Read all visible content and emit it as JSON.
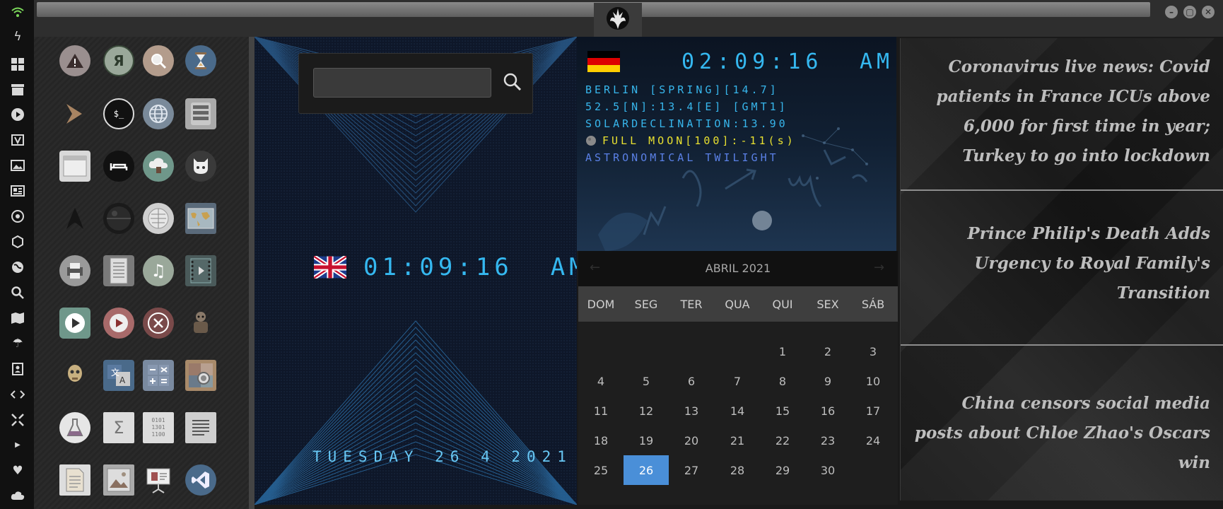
{
  "top": {
    "window_controls": [
      "–",
      "▢",
      "✕"
    ]
  },
  "left_bar": {
    "icons": [
      "wifi-icon",
      "flash-icon",
      "windows-icon",
      "archive-icon",
      "play-icon",
      "translate-map-icon",
      "image-icon",
      "news-icon",
      "rebel-icon",
      "hexagon-icon",
      "globe-icon",
      "search-icon",
      "map-icon",
      "umbrella-icon",
      "contacts-icon",
      "code-icon",
      "resize-icon",
      "youtube-icon",
      "heart-icon",
      "cloud-icon"
    ]
  },
  "launcher": {
    "apps": [
      "warning",
      "yandex",
      "search",
      "hourglass",
      "terminal-arrow",
      "terminal",
      "globe",
      "drive",
      "window",
      "sleep",
      "cloud-lock",
      "github",
      "star-trek",
      "death-star",
      "wikipedia",
      "world-map",
      "printer",
      "document-viewer",
      "music",
      "video",
      "play",
      "youtube-dl",
      "close",
      "robot",
      "c3po",
      "translate",
      "calculator",
      "photos",
      "lab",
      "sigma",
      "binary",
      "text-editor",
      "notes",
      "image",
      "presentation",
      "vscode"
    ]
  },
  "search": {
    "placeholder": "",
    "value": ""
  },
  "uk_clock": {
    "time": "01:09:16",
    "ampm": "AM",
    "date": "TUESDAY 26 4 2021"
  },
  "de_clock": {
    "time": "02:09:16",
    "ampm": "AM",
    "location_line": "BERLIN [SPRING][14.7]",
    "coords_line": "52.5[N]:13.4[E] [GMT1]",
    "declination_line": "SOLARDECLINATION:13.90",
    "moon_line": "FULL MOON[100]:-11(s)",
    "twilight_line": "ASTRONOMICAL TWILIGHT"
  },
  "calendar": {
    "title": "ABRIL 2021",
    "prev": "←",
    "next": "→",
    "weekdays": [
      "DOM",
      "SEG",
      "TER",
      "QUA",
      "QUI",
      "SEX",
      "SÁB"
    ],
    "weeks": [
      [
        "",
        "",
        "",
        "",
        "1",
        "2",
        "3"
      ],
      [
        "4",
        "5",
        "6",
        "7",
        "8",
        "9",
        "10"
      ],
      [
        "11",
        "12",
        "13",
        "14",
        "15",
        "16",
        "17"
      ],
      [
        "18",
        "19",
        "20",
        "21",
        "22",
        "23",
        "24"
      ],
      [
        "25",
        "26",
        "27",
        "28",
        "29",
        "30",
        ""
      ]
    ],
    "today": "26"
  },
  "news": {
    "items": [
      "Coronavirus live news: Covid patients in France ICUs above 6,000 for first time in year; Turkey to go into lockdown",
      "Prince Philip's Death Adds Urgency to Royal Family's Transition",
      "China censors social media posts about Chloe Zhao's Oscars win"
    ]
  },
  "colors": {
    "lcd_blue": "#35b8f0",
    "moon_yellow": "#e8e030",
    "twilight_blue": "#5a80e6",
    "today_highlight": "#4a8fd8"
  }
}
